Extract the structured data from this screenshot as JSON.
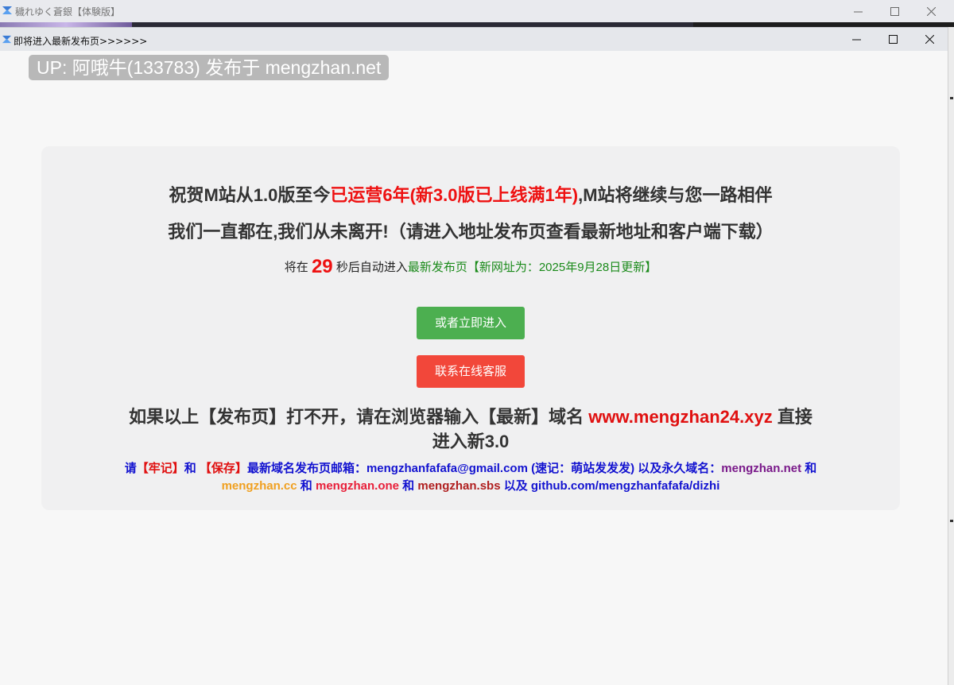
{
  "outer_window": {
    "title": "穢れゆく蒼銀【体験版】"
  },
  "inner_window": {
    "title": "即将进入最新发布页>>>>>>"
  },
  "badge": {
    "text": "UP: 阿哦牛(133783) 发布于 mengzhan.net"
  },
  "card": {
    "line1_a": "祝贺M站从1.0版至今",
    "line1_b": "已运营6年(新3.0版已上线满1年)",
    "line1_c": ",M站将继续与您一路相伴",
    "line2": "我们一直都在,我们从未离开!（请进入地址发布页查看最新地址和客户端下载）",
    "countdown_prefix": "将在",
    "countdown_seconds": "29",
    "countdown_middle": "秒后自动进入",
    "countdown_link": "最新发布页",
    "countdown_note": "【新网址为：2025年9月28日更新】",
    "enter_button": "或者立即进入",
    "service_button": "联系在线客服",
    "fallback_a": "如果以上【发布页】打不开，请在浏览器输入【最新】域名",
    "fallback_domain": "www.mengzhan24.xyz",
    "fallback_b": "直接",
    "fallback_c": "进入新3.0",
    "mail_a": "请",
    "mail_b": "【牢记】",
    "mail_c": "和",
    "mail_d": "【保存】",
    "mail_e": "最新域名发布页邮箱：mengzhanfafafa@gmail.com (速记：萌站发发发) 以及永久域名：",
    "mail_f": "mengzhan.net",
    "mail_g": "和",
    "mail2_a": "mengzhan.cc",
    "mail2_b": "和",
    "mail2_c": "mengzhan.one",
    "mail2_d": "和",
    "mail2_e": "mengzhan.sbs",
    "mail2_f": "以及 github.com/mengzhanfafafa/dizhi"
  },
  "colors": {
    "accent_red": "#ee1111",
    "button_green": "#4caf50",
    "button_red": "#f2473a",
    "link_blue": "#1212d0"
  }
}
